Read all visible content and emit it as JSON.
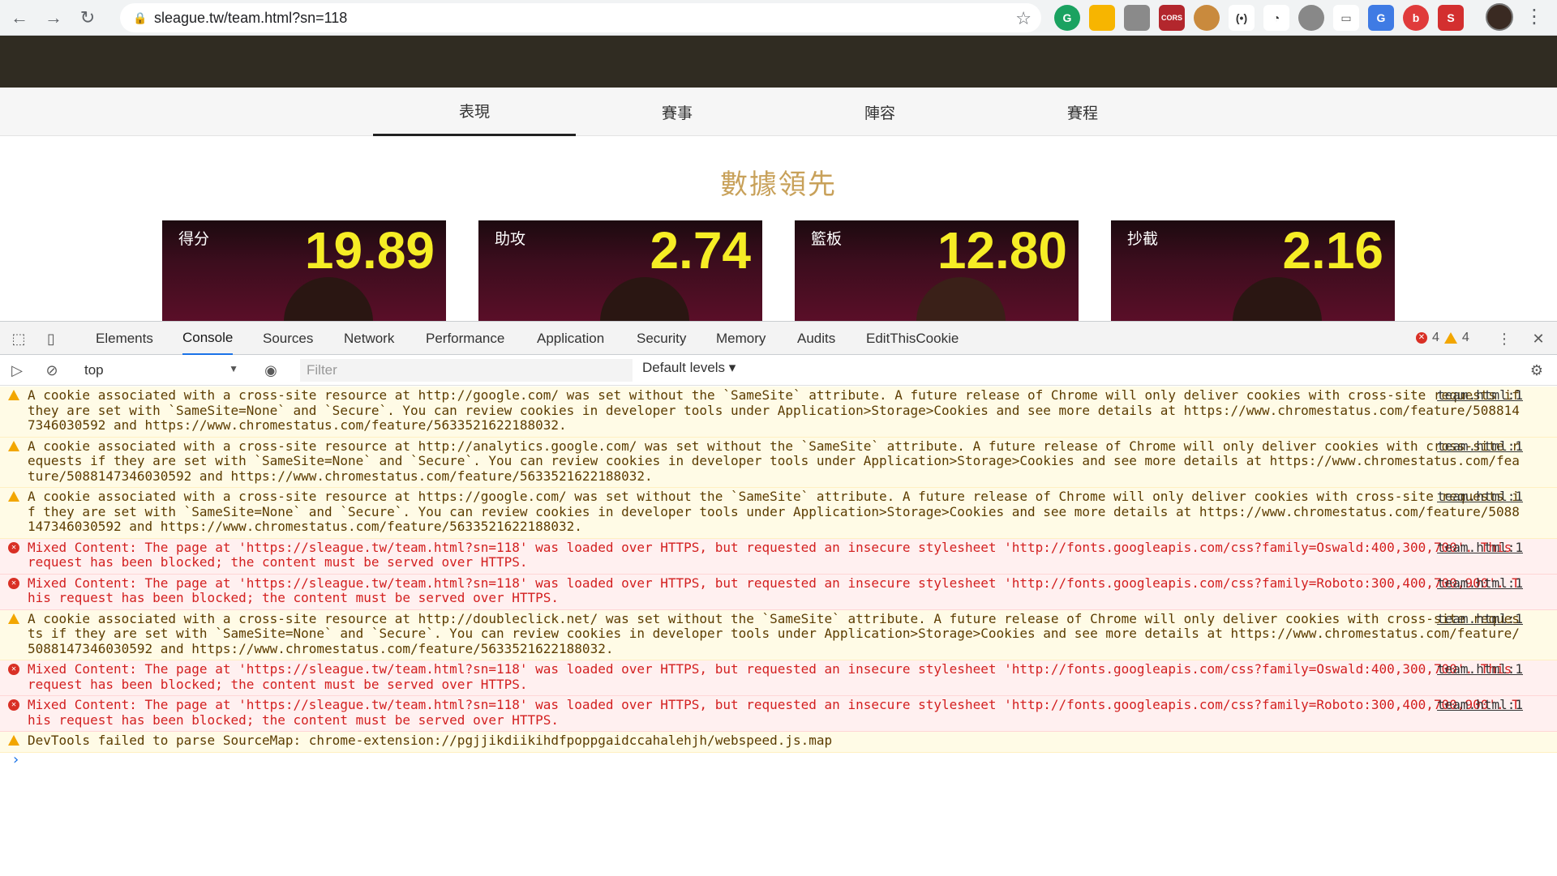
{
  "browser": {
    "url": "sleague.tw/team.html?sn=118"
  },
  "site": {
    "tabs": [
      "表現",
      "賽事",
      "陣容",
      "賽程"
    ],
    "section_title": "數據領先",
    "stats": [
      {
        "label": "得分",
        "value": "19.89"
      },
      {
        "label": "助攻",
        "value": "2.74"
      },
      {
        "label": "籃板",
        "value": "12.80"
      },
      {
        "label": "抄截",
        "value": "2.16"
      }
    ]
  },
  "devtools": {
    "tabs": [
      "Elements",
      "Console",
      "Sources",
      "Network",
      "Performance",
      "Application",
      "Security",
      "Memory",
      "Audits",
      "EditThisCookie"
    ],
    "active_tab": "Console",
    "error_count": "4",
    "warning_count": "4",
    "context": "top",
    "filter_placeholder": "Filter",
    "levels": "Default levels",
    "messages": [
      {
        "type": "warn",
        "text": "A cookie associated with a cross-site resource at http://google.com/ was set without the `SameSite` attribute. A future release of Chrome will only deliver cookies with cross-site requests if they are set with `SameSite=None` and `Secure`. You can review cookies in developer tools under Application>Storage>Cookies and see more details at https://www.chromestatus.com/feature/5088147346030592 and https://www.chromestatus.com/feature/5633521622188032.",
        "source": "team.html:1"
      },
      {
        "type": "warn",
        "text": "A cookie associated with a cross-site resource at http://analytics.google.com/ was set without the `SameSite` attribute. A future release of Chrome will only deliver cookies with cross-site requests if they are set with `SameSite=None` and `Secure`. You can review cookies in developer tools under Application>Storage>Cookies and see more details at https://www.chromestatus.com/feature/5088147346030592 and https://www.chromestatus.com/feature/5633521622188032.",
        "source": "team.html:1"
      },
      {
        "type": "warn",
        "text": "A cookie associated with a cross-site resource at https://google.com/ was set without the `SameSite` attribute. A future release of Chrome will only deliver cookies with cross-site requests if they are set with `SameSite=None` and `Secure`. You can review cookies in developer tools under Application>Storage>Cookies and see more details at https://www.chromestatus.com/feature/5088147346030592 and https://www.chromestatus.com/feature/5633521622188032.",
        "source": "team.html:1"
      },
      {
        "type": "error",
        "text": "Mixed Content: The page at 'https://sleague.tw/team.html?sn=118' was loaded over HTTPS, but requested an insecure stylesheet 'http://fonts.googleapis.com/css?family=Oswald:400,300,700'. This request has been blocked; the content must be served over HTTPS.",
        "source": "team.html:1"
      },
      {
        "type": "error",
        "text": "Mixed Content: The page at 'https://sleague.tw/team.html?sn=118' was loaded over HTTPS, but requested an insecure stylesheet 'http://fonts.googleapis.com/css?family=Roboto:300,400,700,900'. This request has been blocked; the content must be served over HTTPS.",
        "source": "team.html:1"
      },
      {
        "type": "warn",
        "text": "A cookie associated with a cross-site resource at http://doubleclick.net/ was set without the `SameSite` attribute. A future release of Chrome will only deliver cookies with cross-site requests if they are set with `SameSite=None` and `Secure`. You can review cookies in developer tools under Application>Storage>Cookies and see more details at https://www.chromestatus.com/feature/5088147346030592 and https://www.chromestatus.com/feature/5633521622188032.",
        "source": "team.html:1"
      },
      {
        "type": "error",
        "text": "Mixed Content: The page at 'https://sleague.tw/team.html?sn=118' was loaded over HTTPS, but requested an insecure stylesheet 'http://fonts.googleapis.com/css?family=Oswald:400,300,700'. This request has been blocked; the content must be served over HTTPS.",
        "source": "team.html:1"
      },
      {
        "type": "error",
        "text": "Mixed Content: The page at 'https://sleague.tw/team.html?sn=118' was loaded over HTTPS, but requested an insecure stylesheet 'http://fonts.googleapis.com/css?family=Roboto:300,400,700,900'. This request has been blocked; the content must be served over HTTPS.",
        "source": "team.html:1"
      },
      {
        "type": "warn",
        "text": "DevTools failed to parse SourceMap: chrome-extension://pgjjikdiikihdfpoppgaidccahalehjh/webspeed.js.map",
        "source": ""
      }
    ]
  },
  "colors": {
    "accent": "#c8a15a",
    "stat_value": "#f6ed25",
    "header": "#302c22"
  }
}
